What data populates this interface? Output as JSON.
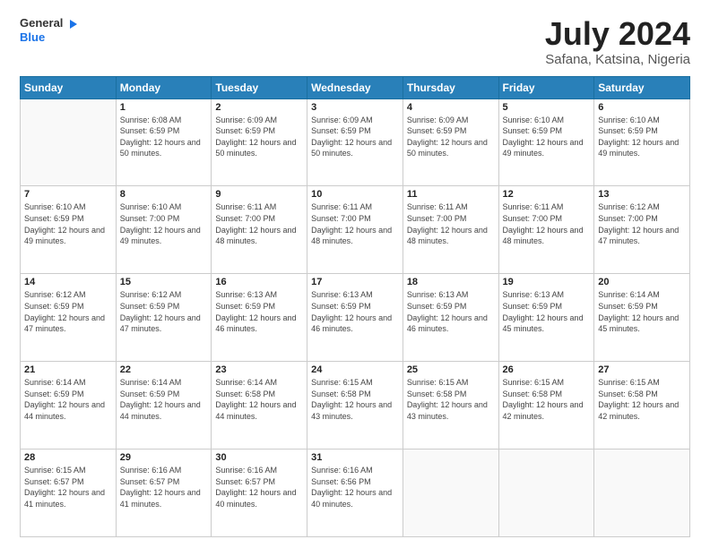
{
  "logo": {
    "line1": "General",
    "line2": "Blue"
  },
  "title": "July 2024",
  "subtitle": "Safana, Katsina, Nigeria",
  "weekdays": [
    "Sunday",
    "Monday",
    "Tuesday",
    "Wednesday",
    "Thursday",
    "Friday",
    "Saturday"
  ],
  "weeks": [
    [
      {
        "day": "",
        "sunrise": "",
        "sunset": "",
        "daylight": ""
      },
      {
        "day": "1",
        "sunrise": "Sunrise: 6:08 AM",
        "sunset": "Sunset: 6:59 PM",
        "daylight": "Daylight: 12 hours and 50 minutes."
      },
      {
        "day": "2",
        "sunrise": "Sunrise: 6:09 AM",
        "sunset": "Sunset: 6:59 PM",
        "daylight": "Daylight: 12 hours and 50 minutes."
      },
      {
        "day": "3",
        "sunrise": "Sunrise: 6:09 AM",
        "sunset": "Sunset: 6:59 PM",
        "daylight": "Daylight: 12 hours and 50 minutes."
      },
      {
        "day": "4",
        "sunrise": "Sunrise: 6:09 AM",
        "sunset": "Sunset: 6:59 PM",
        "daylight": "Daylight: 12 hours and 50 minutes."
      },
      {
        "day": "5",
        "sunrise": "Sunrise: 6:10 AM",
        "sunset": "Sunset: 6:59 PM",
        "daylight": "Daylight: 12 hours and 49 minutes."
      },
      {
        "day": "6",
        "sunrise": "Sunrise: 6:10 AM",
        "sunset": "Sunset: 6:59 PM",
        "daylight": "Daylight: 12 hours and 49 minutes."
      }
    ],
    [
      {
        "day": "7",
        "sunrise": "Sunrise: 6:10 AM",
        "sunset": "Sunset: 6:59 PM",
        "daylight": "Daylight: 12 hours and 49 minutes."
      },
      {
        "day": "8",
        "sunrise": "Sunrise: 6:10 AM",
        "sunset": "Sunset: 7:00 PM",
        "daylight": "Daylight: 12 hours and 49 minutes."
      },
      {
        "day": "9",
        "sunrise": "Sunrise: 6:11 AM",
        "sunset": "Sunset: 7:00 PM",
        "daylight": "Daylight: 12 hours and 48 minutes."
      },
      {
        "day": "10",
        "sunrise": "Sunrise: 6:11 AM",
        "sunset": "Sunset: 7:00 PM",
        "daylight": "Daylight: 12 hours and 48 minutes."
      },
      {
        "day": "11",
        "sunrise": "Sunrise: 6:11 AM",
        "sunset": "Sunset: 7:00 PM",
        "daylight": "Daylight: 12 hours and 48 minutes."
      },
      {
        "day": "12",
        "sunrise": "Sunrise: 6:11 AM",
        "sunset": "Sunset: 7:00 PM",
        "daylight": "Daylight: 12 hours and 48 minutes."
      },
      {
        "day": "13",
        "sunrise": "Sunrise: 6:12 AM",
        "sunset": "Sunset: 7:00 PM",
        "daylight": "Daylight: 12 hours and 47 minutes."
      }
    ],
    [
      {
        "day": "14",
        "sunrise": "Sunrise: 6:12 AM",
        "sunset": "Sunset: 6:59 PM",
        "daylight": "Daylight: 12 hours and 47 minutes."
      },
      {
        "day": "15",
        "sunrise": "Sunrise: 6:12 AM",
        "sunset": "Sunset: 6:59 PM",
        "daylight": "Daylight: 12 hours and 47 minutes."
      },
      {
        "day": "16",
        "sunrise": "Sunrise: 6:13 AM",
        "sunset": "Sunset: 6:59 PM",
        "daylight": "Daylight: 12 hours and 46 minutes."
      },
      {
        "day": "17",
        "sunrise": "Sunrise: 6:13 AM",
        "sunset": "Sunset: 6:59 PM",
        "daylight": "Daylight: 12 hours and 46 minutes."
      },
      {
        "day": "18",
        "sunrise": "Sunrise: 6:13 AM",
        "sunset": "Sunset: 6:59 PM",
        "daylight": "Daylight: 12 hours and 46 minutes."
      },
      {
        "day": "19",
        "sunrise": "Sunrise: 6:13 AM",
        "sunset": "Sunset: 6:59 PM",
        "daylight": "Daylight: 12 hours and 45 minutes."
      },
      {
        "day": "20",
        "sunrise": "Sunrise: 6:14 AM",
        "sunset": "Sunset: 6:59 PM",
        "daylight": "Daylight: 12 hours and 45 minutes."
      }
    ],
    [
      {
        "day": "21",
        "sunrise": "Sunrise: 6:14 AM",
        "sunset": "Sunset: 6:59 PM",
        "daylight": "Daylight: 12 hours and 44 minutes."
      },
      {
        "day": "22",
        "sunrise": "Sunrise: 6:14 AM",
        "sunset": "Sunset: 6:59 PM",
        "daylight": "Daylight: 12 hours and 44 minutes."
      },
      {
        "day": "23",
        "sunrise": "Sunrise: 6:14 AM",
        "sunset": "Sunset: 6:58 PM",
        "daylight": "Daylight: 12 hours and 44 minutes."
      },
      {
        "day": "24",
        "sunrise": "Sunrise: 6:15 AM",
        "sunset": "Sunset: 6:58 PM",
        "daylight": "Daylight: 12 hours and 43 minutes."
      },
      {
        "day": "25",
        "sunrise": "Sunrise: 6:15 AM",
        "sunset": "Sunset: 6:58 PM",
        "daylight": "Daylight: 12 hours and 43 minutes."
      },
      {
        "day": "26",
        "sunrise": "Sunrise: 6:15 AM",
        "sunset": "Sunset: 6:58 PM",
        "daylight": "Daylight: 12 hours and 42 minutes."
      },
      {
        "day": "27",
        "sunrise": "Sunrise: 6:15 AM",
        "sunset": "Sunset: 6:58 PM",
        "daylight": "Daylight: 12 hours and 42 minutes."
      }
    ],
    [
      {
        "day": "28",
        "sunrise": "Sunrise: 6:15 AM",
        "sunset": "Sunset: 6:57 PM",
        "daylight": "Daylight: 12 hours and 41 minutes."
      },
      {
        "day": "29",
        "sunrise": "Sunrise: 6:16 AM",
        "sunset": "Sunset: 6:57 PM",
        "daylight": "Daylight: 12 hours and 41 minutes."
      },
      {
        "day": "30",
        "sunrise": "Sunrise: 6:16 AM",
        "sunset": "Sunset: 6:57 PM",
        "daylight": "Daylight: 12 hours and 40 minutes."
      },
      {
        "day": "31",
        "sunrise": "Sunrise: 6:16 AM",
        "sunset": "Sunset: 6:56 PM",
        "daylight": "Daylight: 12 hours and 40 minutes."
      },
      {
        "day": "",
        "sunrise": "",
        "sunset": "",
        "daylight": ""
      },
      {
        "day": "",
        "sunrise": "",
        "sunset": "",
        "daylight": ""
      },
      {
        "day": "",
        "sunrise": "",
        "sunset": "",
        "daylight": ""
      }
    ]
  ]
}
